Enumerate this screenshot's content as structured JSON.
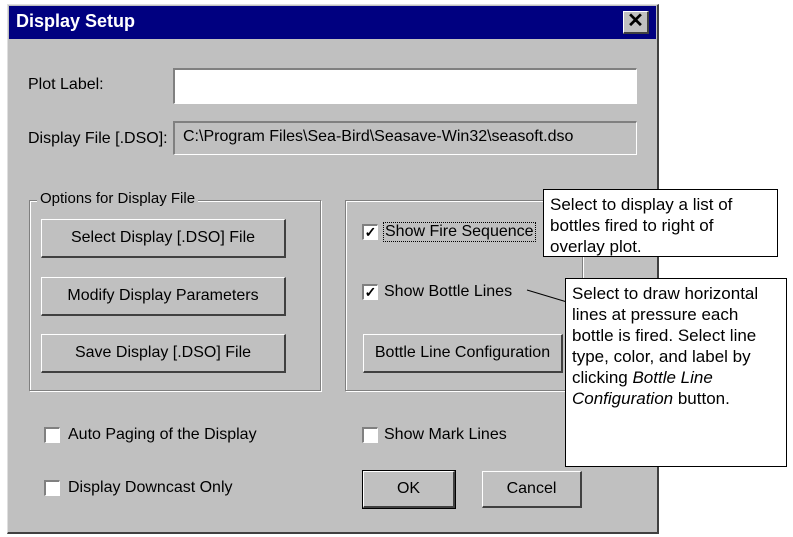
{
  "window": {
    "title": "Display Setup",
    "close_glyph": "✕"
  },
  "plot_label": {
    "label": "Plot Label:",
    "value": ""
  },
  "display_file": {
    "label": "Display File [.DSO]:",
    "value": "C:\\Program Files\\Sea-Bird\\Seasave-Win32\\seasoft.dso"
  },
  "options_group": {
    "label": "Options for Display File",
    "select_button": "Select Display [.DSO] File",
    "modify_button": "Modify Display Parameters",
    "save_button": "Save Display [.DSO] File"
  },
  "right_group": {
    "show_fire_sequence": {
      "label": "Show Fire Sequence",
      "checked": true
    },
    "show_bottle_lines": {
      "label": "Show Bottle Lines",
      "checked": true
    },
    "bottle_line_config_button": "Bottle Line Configuration"
  },
  "auto_paging": {
    "label": "Auto Paging of the Display",
    "checked": false
  },
  "downcast_only": {
    "label": "Display Downcast Only",
    "checked": false
  },
  "show_mark_lines": {
    "label": "Show Mark Lines",
    "checked": false
  },
  "ok_button": "OK",
  "cancel_button": "Cancel",
  "check_glyph": "✓",
  "callouts": {
    "fire_sequence": "Select to display a list of bottles fired to right of overlay plot.",
    "bottle_lines_part1": "Select to draw horizontal lines at pressure each bottle is fired. Select line type, color, and label by clicking ",
    "bottle_lines_em1": "Bottle Line Configuration",
    "bottle_lines_part2": " button."
  },
  "colors": {
    "titlebar": "#000080",
    "face": "#c0c0c0"
  }
}
